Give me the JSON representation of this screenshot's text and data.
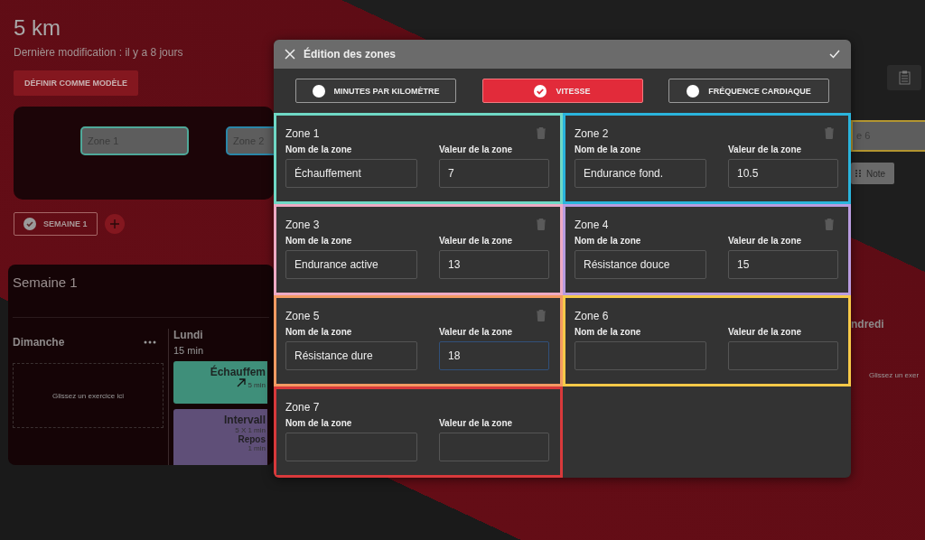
{
  "page": {
    "title": "5 km",
    "subtitle": "Dernière modification : il y a 8 jours",
    "template_button": "DÉFINIR COMME MODÈLE",
    "zone_chips": [
      {
        "label": "Zone 1",
        "color": "#4fa899"
      },
      {
        "label": "Zone 2",
        "color": "#2a86a8"
      }
    ],
    "week_button": {
      "label": "SEMAINE 1",
      "selected": true
    },
    "week": {
      "title": "Semaine 1",
      "days": [
        {
          "name": "Dimanche",
          "drop_hint": "Glissez un exercice ici"
        },
        {
          "name": "Lundi",
          "duration": "15 min",
          "workouts": [
            {
              "kind": "warmup",
              "title": "Échauffem",
              "detail": "5 min",
              "color": "#3f8f7a"
            },
            {
              "kind": "interval",
              "title": "Intervall",
              "detail": "5 X 1 min",
              "rest_label": "Repos",
              "rest": "1 min",
              "color": "#5f4f78"
            }
          ]
        }
      ]
    },
    "right": {
      "zone_chip": {
        "label": "e 6",
        "color": "#b39530"
      },
      "note_button": "Note",
      "day": "ndredi",
      "drop_hint": "Glissez un exer"
    }
  },
  "modal": {
    "title": "Édition des zones",
    "modes": [
      {
        "label": "MINUTES PAR KILOMÈTRE",
        "selected": false
      },
      {
        "label": "VITESSE",
        "selected": true
      },
      {
        "label": "FRÉQUENCE CARDIAQUE",
        "selected": false
      }
    ],
    "zones": [
      {
        "title": "Zone 1",
        "name_label": "Nom de la zone",
        "value_label": "Valeur de la zone",
        "name": "Échauffement",
        "value": "7",
        "color": "#6fd8c5",
        "deletable": true,
        "value_focused": false
      },
      {
        "title": "Zone 2",
        "name_label": "Nom de la zone",
        "value_label": "Valeur de la zone",
        "name": "Endurance fond.",
        "value": "10.5",
        "color": "#2ab4dc",
        "deletable": true,
        "value_focused": false
      },
      {
        "title": "Zone 3",
        "name_label": "Nom de la zone",
        "value_label": "Valeur de la zone",
        "name": "Endurance active",
        "value": "13",
        "color": "#eeaac4",
        "deletable": true,
        "value_focused": false
      },
      {
        "title": "Zone 4",
        "name_label": "Nom de la zone",
        "value_label": "Valeur de la zone",
        "name": "Résistance douce",
        "value": "15",
        "color": "#b99ce0",
        "deletable": true,
        "value_focused": false
      },
      {
        "title": "Zone 5",
        "name_label": "Nom de la zone",
        "value_label": "Valeur de la zone",
        "name": "Résistance dure",
        "value": "18",
        "color": "#f39a62",
        "deletable": true,
        "value_focused": true
      },
      {
        "title": "Zone 6",
        "name_label": "Nom de la zone",
        "value_label": "Valeur de la zone",
        "color": "#f6c948",
        "deletable": false,
        "value_focused": false
      },
      {
        "title": "Zone 7",
        "name_label": "Nom de la zone",
        "value_label": "Valeur de la zone",
        "color": "#d9393b",
        "deletable": false,
        "value_focused": false
      }
    ]
  }
}
